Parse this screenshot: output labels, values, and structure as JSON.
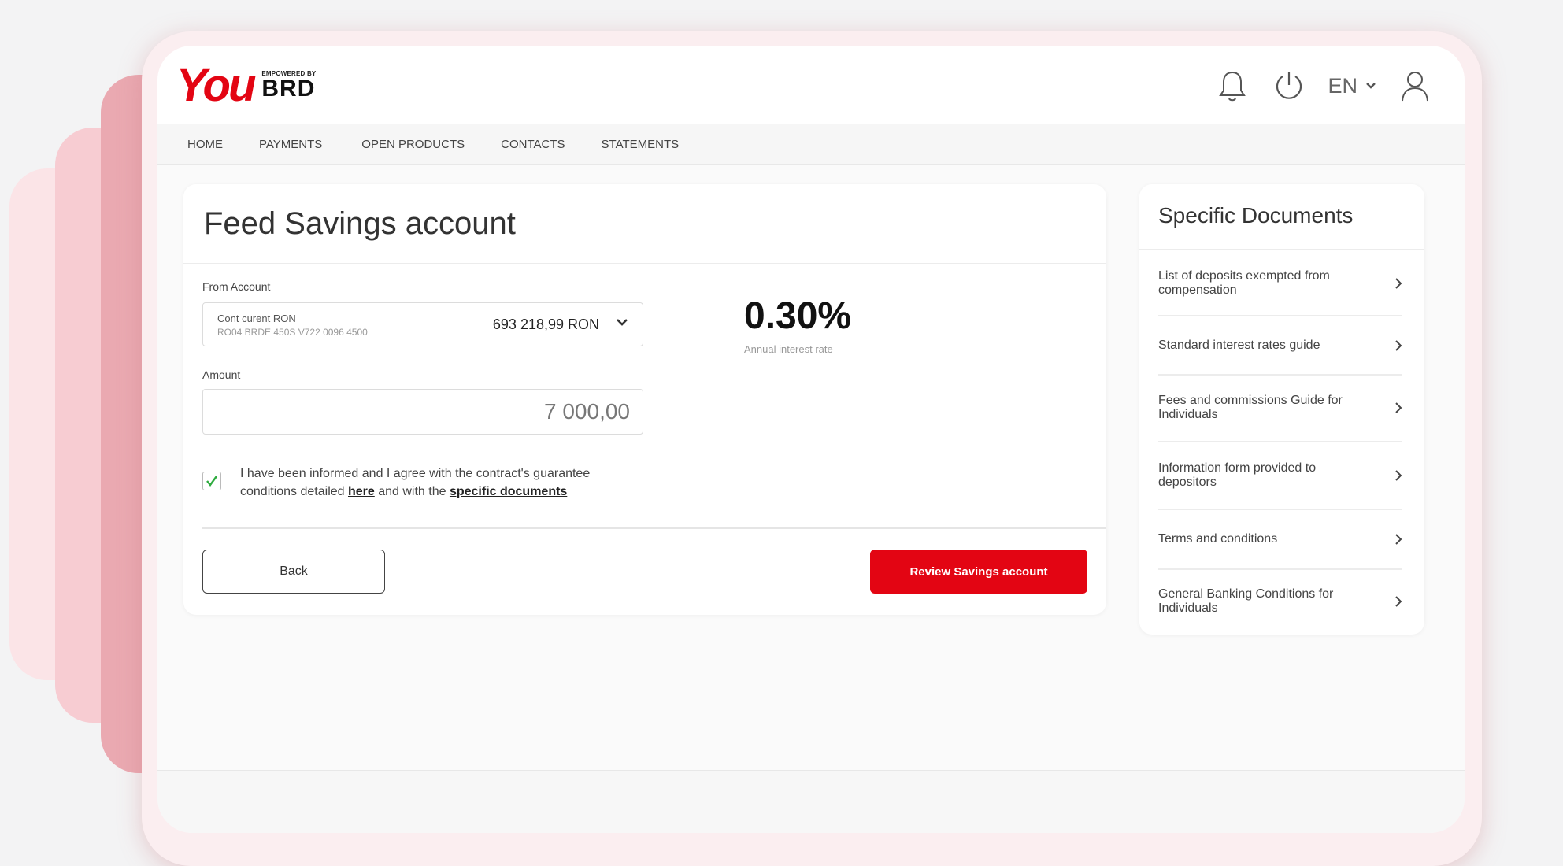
{
  "brand": {
    "you": "You",
    "powered": "EMPOWERED BY",
    "brd": "BRD",
    "color": "#e30513"
  },
  "header": {
    "icons": [
      "bell-icon",
      "power-icon",
      "user-icon"
    ],
    "language": "EN"
  },
  "nav": {
    "items": [
      "HOME",
      "PAYMENTS",
      "OPEN PRODUCTS",
      "CONTACTS",
      "STATEMENTS"
    ]
  },
  "form": {
    "title": "Feed Savings account",
    "from_account_label": "From Account",
    "account": {
      "name": "Cont curent RON",
      "iban": "RO04 BRDE 450S V722 0096 4500",
      "balance": "693 218,99 RON"
    },
    "amount_label": "Amount",
    "amount_value": "7 000,00",
    "interest_rate": "0.30%",
    "interest_rate_label": "Annual interest rate",
    "consent": {
      "checked": true,
      "text_1": "I have been informed and I agree with the contract's guarantee conditions detailed ",
      "link_here": "here",
      "text_2": " and with the ",
      "link_docs": "specific documents"
    },
    "back_label": "Back",
    "review_label": "Review Savings account"
  },
  "documents": {
    "title": "Specific Documents",
    "items": [
      "List of deposits exempted from compensation",
      "Standard interest rates guide",
      "Fees and commissions Guide for Individuals",
      "Information form provided to depositors",
      "Terms and conditions",
      "General Banking Conditions for Individuals"
    ]
  }
}
